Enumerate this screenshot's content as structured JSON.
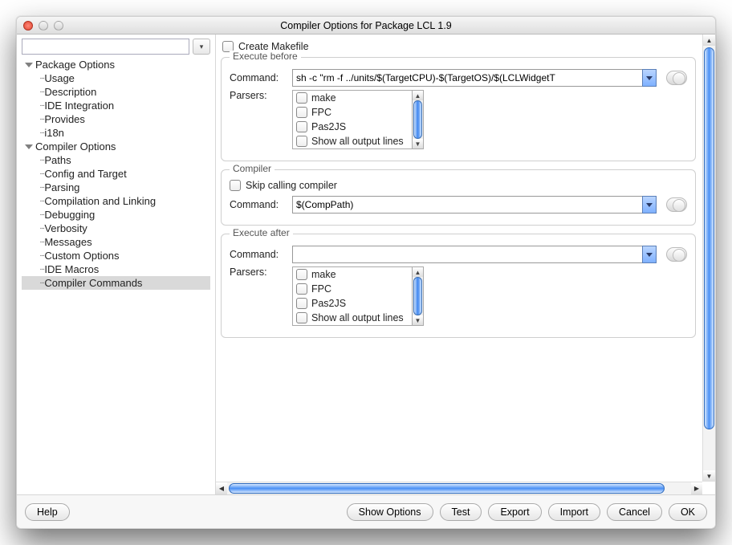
{
  "window": {
    "title": "Compiler Options for Package LCL 1.9"
  },
  "search": {
    "placeholder": ""
  },
  "tree": {
    "groups": [
      {
        "label": "Package Options",
        "items": [
          "Usage",
          "Description",
          "IDE Integration",
          "Provides",
          "i18n"
        ]
      },
      {
        "label": "Compiler Options",
        "items": [
          "Paths",
          "Config and Target",
          "Parsing",
          "Compilation and Linking",
          "Debugging",
          "Verbosity",
          "Messages",
          "Custom Options",
          "IDE Macros",
          "Compiler Commands"
        ]
      }
    ],
    "selected": "Compiler Commands"
  },
  "main": {
    "create_makefile_label": "Create Makefile",
    "execute_before": {
      "title": "Execute before",
      "command_label": "Command:",
      "command_value": "sh -c \"rm -f ../units/$(TargetCPU)-$(TargetOS)/$(LCLWidgetT",
      "parsers_label": "Parsers:",
      "parsers": [
        "make",
        "FPC",
        "Pas2JS",
        "Show all output lines"
      ]
    },
    "compiler": {
      "title": "Compiler",
      "skip_label": "Skip calling compiler",
      "command_label": "Command:",
      "command_value": "$(CompPath)"
    },
    "execute_after": {
      "title": "Execute after",
      "command_label": "Command:",
      "command_value": "",
      "parsers_label": "Parsers:",
      "parsers": [
        "make",
        "FPC",
        "Pas2JS",
        "Show all output lines"
      ]
    }
  },
  "footer": {
    "help": "Help",
    "show_options": "Show Options",
    "test": "Test",
    "export": "Export",
    "import": "Import",
    "cancel": "Cancel",
    "ok": "OK"
  }
}
